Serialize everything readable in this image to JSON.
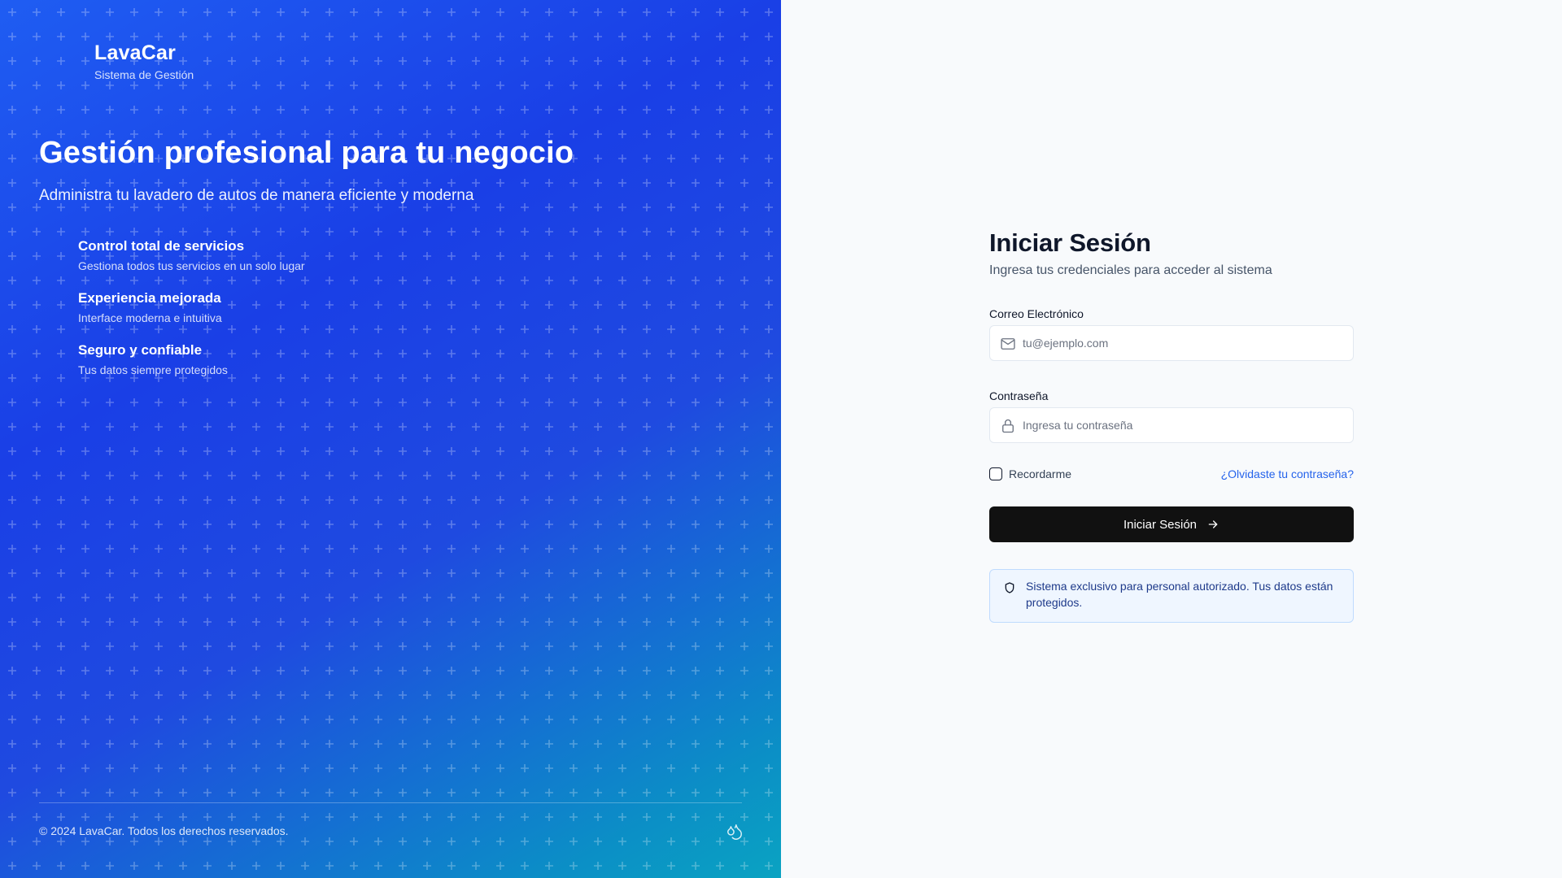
{
  "brand": {
    "title": "LavaCar",
    "subtitle": "Sistema de Gestión"
  },
  "hero": {
    "heading": "Gestión profesional para tu negocio",
    "lead": "Administra tu lavadero de autos de manera eficiente y moderna",
    "features": [
      {
        "title": "Control total de servicios",
        "description": "Gestiona todos tus servicios en un solo lugar"
      },
      {
        "title": "Experiencia mejorada",
        "description": "Interface moderna e intuitiva"
      },
      {
        "title": "Seguro y confiable",
        "description": "Tus datos siempre protegidos"
      }
    ],
    "copyright": "© 2024 LavaCar. Todos los derechos reservados.",
    "footer_icon": "droplets-icon"
  },
  "login": {
    "title": "Iniciar Sesión",
    "subtitle": "Ingresa tus credenciales para acceder al sistema",
    "email": {
      "label": "Correo Electrónico",
      "placeholder": "tu@ejemplo.com",
      "value": "",
      "icon": "mail-icon"
    },
    "password": {
      "label": "Contraseña",
      "placeholder": "Ingresa tu contraseña",
      "value": "",
      "icon": "lock-icon"
    },
    "remember_label": "Recordarme",
    "forgot_label": "¿Olvidaste tu contraseña?",
    "submit_label": "Iniciar Sesión",
    "notice": "Sistema exclusivo para personal autorizado. Tus datos están protegidos."
  },
  "colors": {
    "primary_button": "#111111",
    "link": "#2563eb",
    "notice_bg": "#eff6ff",
    "hero_start": "#1f5df2",
    "hero_end": "#0aa3c2"
  }
}
